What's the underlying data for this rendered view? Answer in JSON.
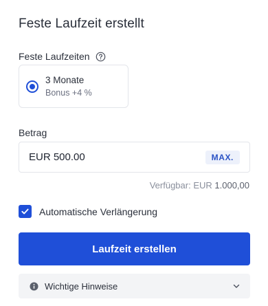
{
  "header": {
    "title": "Feste Laufzeit erstellt"
  },
  "terms": {
    "label": "Feste Laufzeiten",
    "options": [
      {
        "name": "3 Monate",
        "bonus": "Bonus +4 %",
        "selected": true
      }
    ]
  },
  "amount": {
    "label": "Betrag",
    "value": "EUR 500.00",
    "max_label": "MAX.",
    "available_prefix": "Verfügbar: EUR",
    "available_value": "1.000,00"
  },
  "auto_renew": {
    "label": "Automatische Verlängerung",
    "checked": true
  },
  "submit": {
    "label": "Laufzeit erstellen"
  },
  "notes": {
    "label": "Wichtige Hinweise"
  },
  "colors": {
    "accent": "#1f4fd8",
    "max_bg": "#edf1fb",
    "notes_bg": "#f3f4f6"
  }
}
